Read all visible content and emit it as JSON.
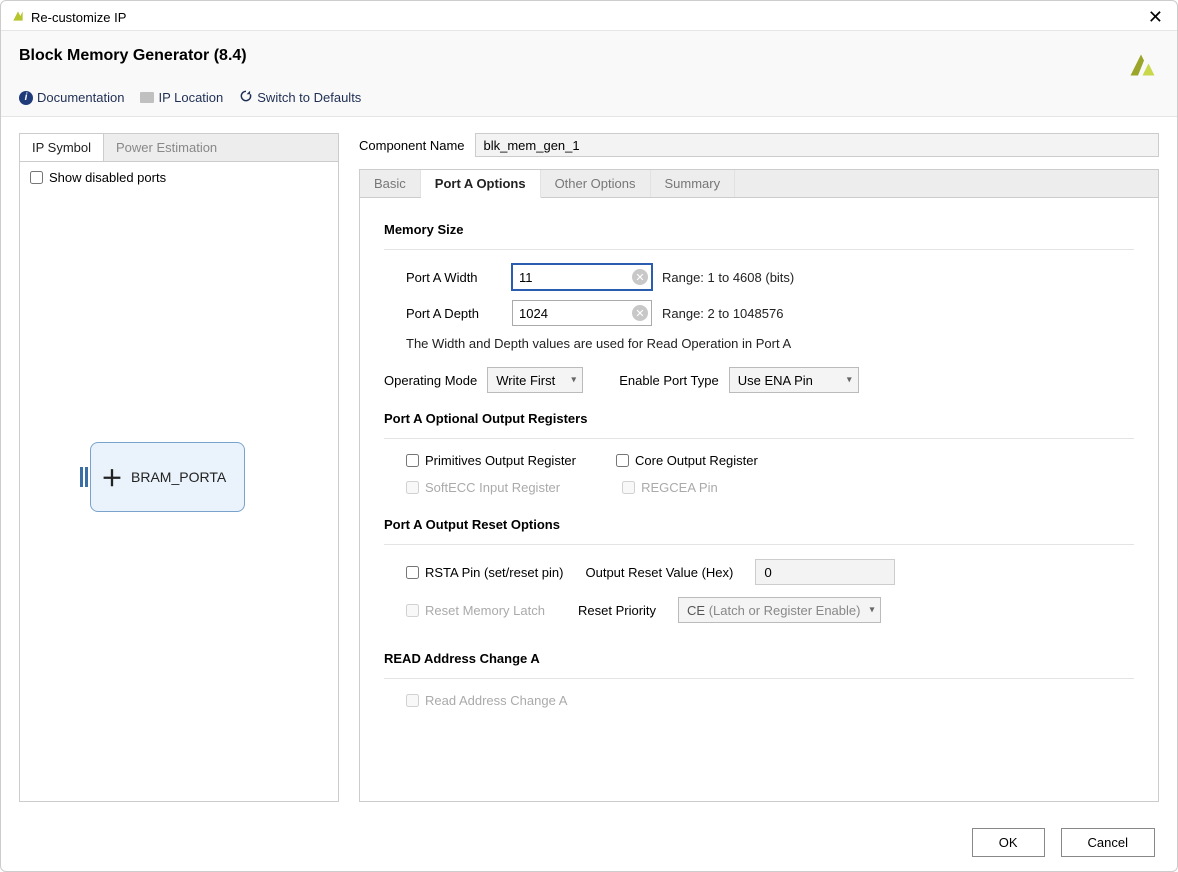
{
  "window": {
    "title": "Re-customize IP"
  },
  "header": {
    "product_title": "Block Memory Generator (8.4)",
    "links": {
      "documentation": "Documentation",
      "ip_location": "IP Location",
      "switch_defaults": "Switch to Defaults"
    }
  },
  "left": {
    "tabs": {
      "ip_symbol": "IP Symbol",
      "power_estimation": "Power Estimation"
    },
    "show_disabled_ports": "Show disabled ports",
    "bram_label": "BRAM_PORTA"
  },
  "comp_name": {
    "label": "Component Name",
    "value": "blk_mem_gen_1"
  },
  "tabs": {
    "basic": "Basic",
    "port_a": "Port A Options",
    "other": "Other Options",
    "summary": "Summary"
  },
  "memsize": {
    "title": "Memory Size",
    "width_label": "Port A Width",
    "width_value": "11",
    "width_hint": "Range: 1 to 4608 (bits)",
    "depth_label": "Port A Depth",
    "depth_value": "1024",
    "depth_hint": "Range: 2 to 1048576",
    "note": "The Width and Depth values are used for Read Operation in Port A",
    "op_mode_label": "Operating Mode",
    "op_mode_value": "Write First",
    "enable_label": "Enable Port Type",
    "enable_value": "Use ENA Pin"
  },
  "optreg": {
    "title": "Port A Optional Output Registers",
    "primitives": "Primitives Output Register",
    "core": "Core Output Register",
    "softecc": "SoftECC Input Register",
    "regcea": "REGCEA Pin"
  },
  "reset": {
    "title": "Port A Output Reset Options",
    "rsta": "RSTA Pin (set/reset pin)",
    "orv_label": "Output Reset Value (Hex)",
    "orv_value": "0",
    "rml": "Reset Memory Latch",
    "priority_label": "Reset Priority",
    "priority_value": "CE",
    "priority_hint": "(Latch or Register Enable)"
  },
  "readaddr": {
    "title": "READ Address Change A",
    "chk": "Read Address Change A"
  },
  "footer": {
    "ok": "OK",
    "cancel": "Cancel"
  }
}
